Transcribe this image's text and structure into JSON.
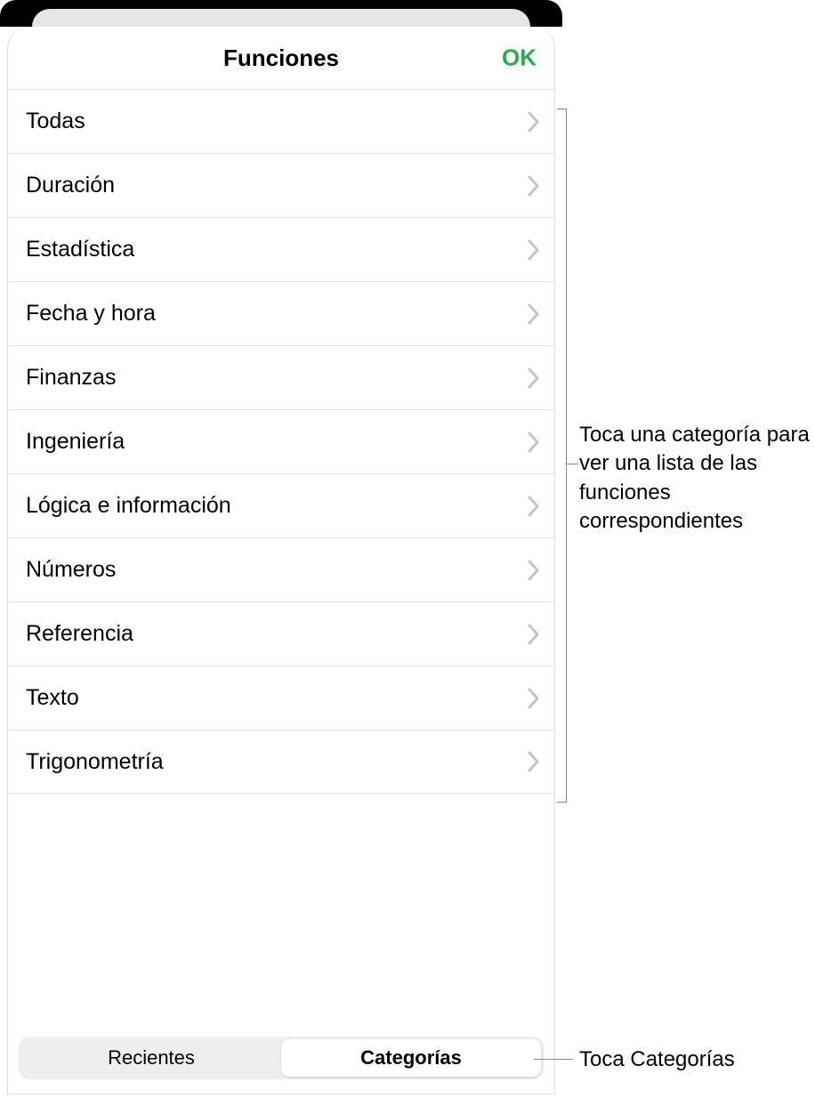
{
  "header": {
    "title": "Funciones",
    "ok_label": "OK"
  },
  "categories": [
    {
      "label": "Todas"
    },
    {
      "label": "Duración"
    },
    {
      "label": "Estadística"
    },
    {
      "label": "Fecha y hora"
    },
    {
      "label": "Finanzas"
    },
    {
      "label": "Ingeniería"
    },
    {
      "label": "Lógica e información"
    },
    {
      "label": "Números"
    },
    {
      "label": "Referencia"
    },
    {
      "label": "Texto"
    },
    {
      "label": "Trigonometría"
    }
  ],
  "tabs": {
    "recientes": "Recientes",
    "categorias": "Categorías"
  },
  "callouts": {
    "list": "Toca una categoría para ver una lista de las funciones correspondientes",
    "tabs": "Toca Categorías"
  }
}
